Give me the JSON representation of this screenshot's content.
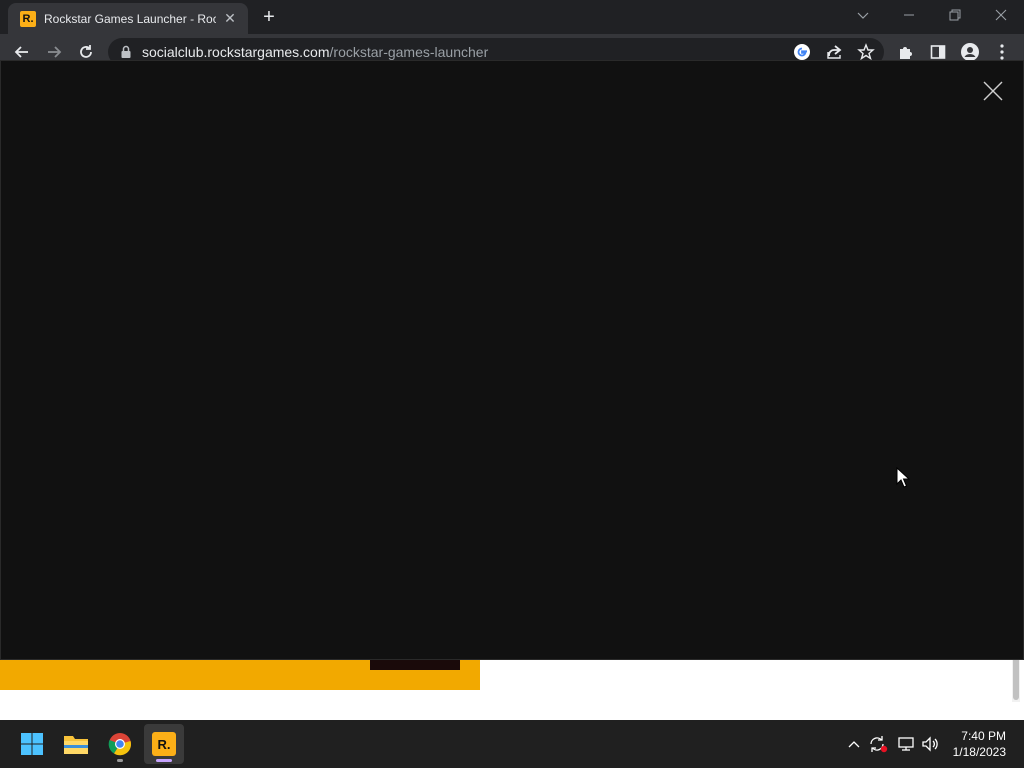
{
  "browser": {
    "tab": {
      "favicon_letter": "R.",
      "title": "Rockstar Games Launcher - Rock",
      "close_glyph": "✕"
    },
    "new_tab_glyph": "+",
    "url": {
      "host": "socialclub.rockstargames.com",
      "path": "/rockstar-games-launcher"
    }
  },
  "icons": {
    "tab_search": "chevron-down-icon",
    "minimize": "minimize-icon",
    "restore": "restore-icon",
    "close_window": "close-icon",
    "back": "back-arrow-icon",
    "forward": "forward-arrow-icon",
    "reload": "reload-icon",
    "lock": "lock-icon",
    "google": "google-icon",
    "share": "share-icon",
    "bookmark": "star-icon",
    "extensions": "puzzle-icon",
    "side_panel": "side-panel-icon",
    "profile": "profile-icon",
    "menu": "kebab-menu-icon",
    "modal_close": "close-icon"
  },
  "colors": {
    "brand_yellow": "#fcaf17",
    "modal_bg": "#111111",
    "page_band": "#f2a900"
  },
  "taskbar": {
    "apps": [
      "start",
      "file-explorer",
      "chrome",
      "rockstar-games-launcher"
    ],
    "rockstar_letter": "R.",
    "time": "7:40 PM",
    "date": "1/18/2023"
  }
}
